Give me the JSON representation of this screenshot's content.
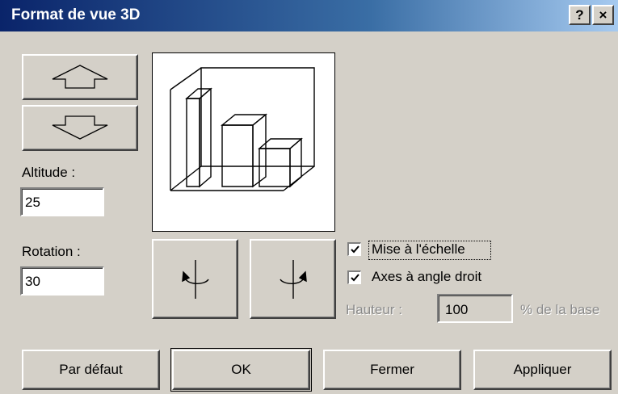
{
  "window": {
    "title": "Format de vue 3D",
    "help_button": "?",
    "close_button": "×"
  },
  "elevation": {
    "up_icon": "arrow-up-icon",
    "down_icon": "arrow-down-icon",
    "label": "Altitude :",
    "value": "25"
  },
  "rotation": {
    "label": "Rotation :",
    "value": "30",
    "left_icon": "rotate-left-icon",
    "right_icon": "rotate-right-icon"
  },
  "preview": {
    "icon": "3d-bar-chart-preview-icon"
  },
  "options": {
    "autoscale": {
      "label": "Mise à l'échelle",
      "checked": true
    },
    "right_angle_axes": {
      "label": "Axes à angle droit",
      "checked": true
    },
    "height": {
      "label": "Hauteur :",
      "value": "100",
      "suffix": "% de la base"
    }
  },
  "buttons": {
    "default": "Par défaut",
    "ok": "OK",
    "close": "Fermer",
    "apply": "Appliquer"
  }
}
